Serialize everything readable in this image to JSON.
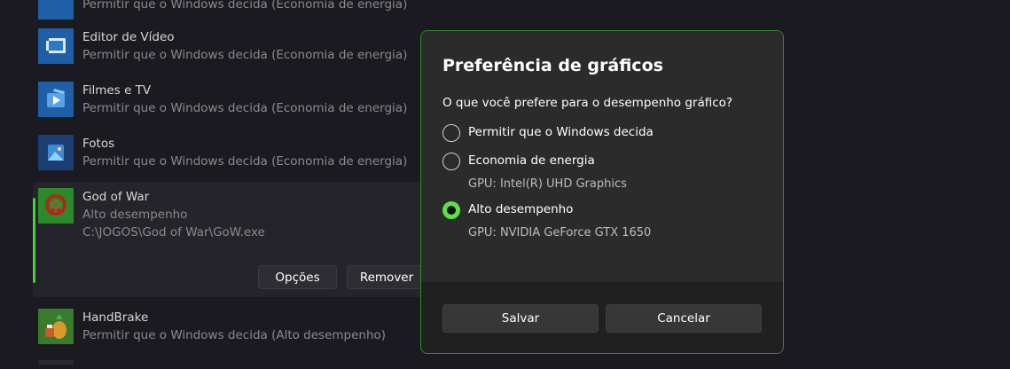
{
  "apps": [
    {
      "name": "",
      "subtitle": "Permitir que o Windows decida (Economia de energia)",
      "icon": "app-tile-icon"
    },
    {
      "name": "Editor de Vídeo",
      "subtitle": "Permitir que o Windows decida (Economia de energia)",
      "icon": "video-editor-icon"
    },
    {
      "name": "Filmes e TV",
      "subtitle": "Permitir que o Windows decida (Economia de energia)",
      "icon": "movies-tv-icon"
    },
    {
      "name": "Fotos",
      "subtitle": "Permitir que o Windows decida (Economia de energia)",
      "icon": "photos-icon"
    }
  ],
  "expanded_app": {
    "name": "God of War",
    "subtitle": "Alto desempenho",
    "path": "C:\\JOGOS\\God of War\\GoW.exe",
    "icon": "god-of-war-icon",
    "options_label": "Opções",
    "remove_label": "Remover"
  },
  "after_apps": [
    {
      "name": "HandBrake",
      "subtitle": "Permitir que o Windows decida (Alto desempenho)",
      "icon": "handbrake-icon"
    }
  ],
  "dialog": {
    "title": "Preferência de gráficos",
    "question": "O que você prefere para o desempenho gráfico?",
    "options": [
      {
        "label": "Permitir que o Windows decida",
        "sub": "",
        "checked": false
      },
      {
        "label": "Economia de energia",
        "sub": "GPU: Intel(R) UHD Graphics",
        "checked": false
      },
      {
        "label": "Alto desempenho",
        "sub": "GPU: NVIDIA GeForce GTX 1650",
        "checked": true
      }
    ],
    "save_label": "Salvar",
    "cancel_label": "Cancelar"
  },
  "colors": {
    "accent": "#5de04a",
    "dialog_border": "#2f8a2e",
    "background": "#1b1a20"
  }
}
